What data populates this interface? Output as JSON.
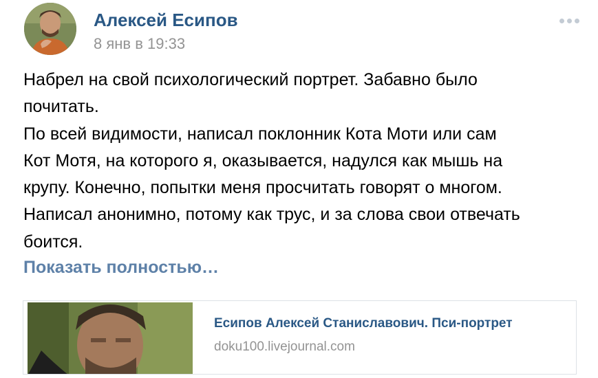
{
  "post": {
    "author": "Алексей Есипов",
    "date": "8 янв в 19:33",
    "more_icon": "ellipsis-icon",
    "text_lines": [
      "Набрел на свой психологический портрет. Забавно было",
      "почитать.",
      "По всей видимости, написал поклонник Кота Моти или сам",
      "Кот Мотя, на которого я, оказывается, надулся как мышь на",
      "крупу. Конечно, попытки меня просчитать говорят о многом.",
      "Написал анонимно, потому как трус, и за слова свои отвечать",
      "боится."
    ],
    "show_more": "Показать полностью…"
  },
  "link_card": {
    "title": "Есипов Алексей Станиславович. Пси-портрет",
    "domain": "doku100.livejournal.com"
  },
  "colors": {
    "author": "#2a5885",
    "meta": "#939393",
    "show_more": "#5e81a8",
    "card_border": "#dce1e6"
  }
}
